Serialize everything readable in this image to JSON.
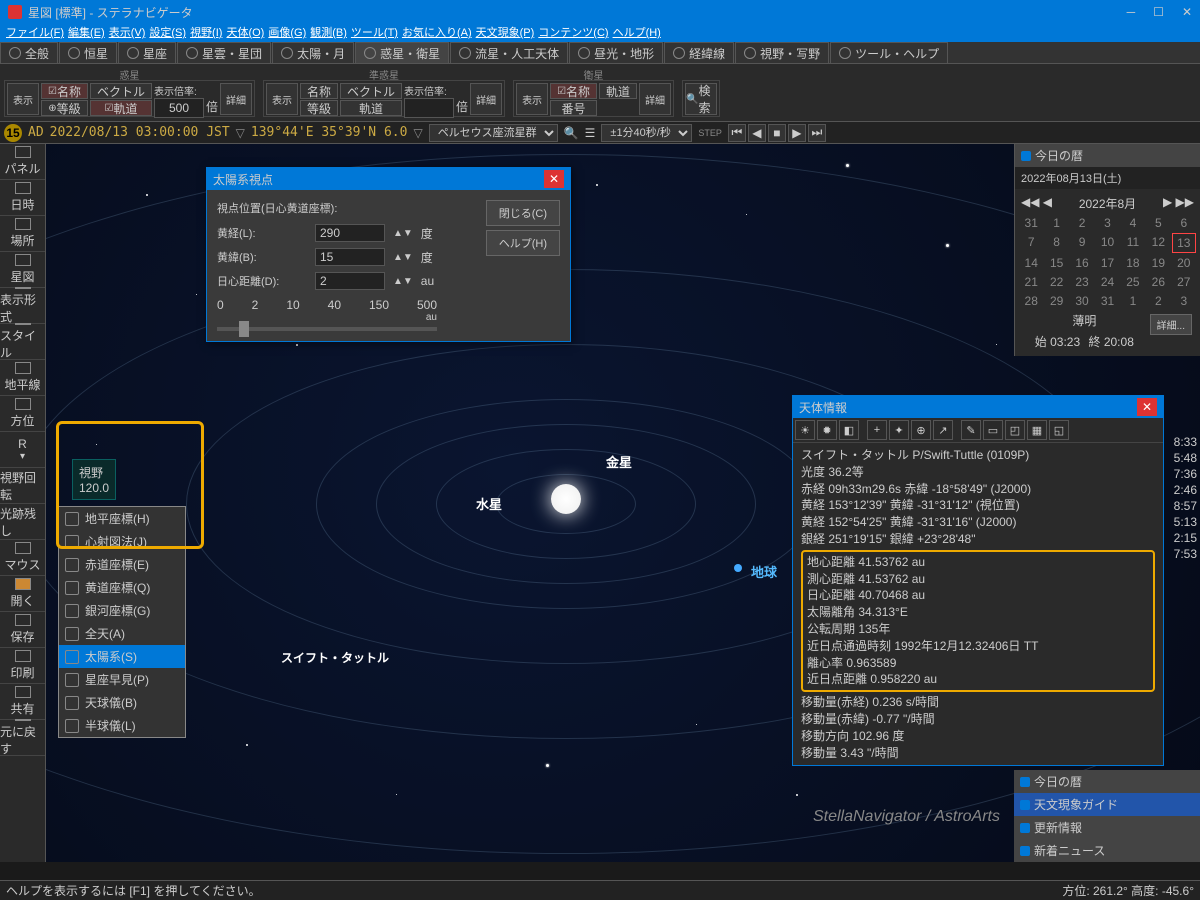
{
  "title": "星図 [標準] - ステラナビゲータ",
  "menubar": [
    "ファイル(F)",
    "編集(E)",
    "表示(V)",
    "設定(S)",
    "視野(I)",
    "天体(O)",
    "画像(G)",
    "観測(B)",
    "ツール(T)",
    "お気に入り(A)",
    "天文現象(P)",
    "コンテンツ(C)",
    "ヘルプ(H)"
  ],
  "tabs": [
    "全般",
    "恒星",
    "星座",
    "星雲・星団",
    "太陽・月",
    "惑星・衛星",
    "流星・人工天体",
    "昼光・地形",
    "経緯線",
    "視野・写野",
    "ツール・ヘルプ"
  ],
  "active_tab": 5,
  "toolbar_groups": {
    "planets": "惑星",
    "dwarfs": "準惑星",
    "satellites": "衛星"
  },
  "toolbar_buttons": {
    "display": "表示",
    "name": "名称",
    "vector": "ベクトル",
    "magnification": "表示倍率:",
    "detail": "詳細",
    "magnitude": "等級",
    "orbit": "軌道",
    "number": "番号",
    "search": "検索",
    "multiplier": "倍"
  },
  "toolbar_values": {
    "mag_planet": "500",
    "mag_dwarf": ""
  },
  "time": {
    "prefix": "AD",
    "datetime": "2022/08/13 03:00:00 JST",
    "coords": "139°44'E 35°39'N  6.0",
    "dropdown1": "ペルセウス座流星群",
    "dropdown2": "±1分40秒/秒",
    "badge": "15"
  },
  "sidebar": [
    "パネル",
    "日時",
    "場所",
    "星図",
    "表示形式",
    "スタイル",
    "地平線",
    "方位",
    "R",
    "視野回転",
    "光跡残し",
    "マウス",
    "開く",
    "保存",
    "印刷",
    "共有",
    "元に戻す"
  ],
  "fov": {
    "label": "視野",
    "value": "120.0"
  },
  "coord_menu": [
    "地平座標(H)",
    "心射図法(J)",
    "赤道座標(E)",
    "黄道座標(Q)",
    "銀河座標(G)",
    "全天(A)",
    "太陽系(S)",
    "星座早見(P)",
    "天球儀(B)",
    "半球儀(L)"
  ],
  "planets": {
    "mercury": "水星",
    "venus": "金星",
    "earth": "地球",
    "swift": "スイフト・タットル"
  },
  "viewpoint_dialog": {
    "title": "太陽系視点",
    "section": "視点位置(日心黄道座標):",
    "lon_label": "黄経(L):",
    "lon": "290",
    "lon_unit": "度",
    "lat_label": "黄緯(B):",
    "lat": "15",
    "lat_unit": "度",
    "dist_label": "日心距離(D):",
    "dist": "2",
    "dist_unit": "au",
    "scale": [
      "0",
      "2",
      "10",
      "40",
      "150",
      "500"
    ],
    "scale_unit": "au",
    "close": "閉じる(C)",
    "help": "ヘルプ(H)"
  },
  "info_dialog": {
    "title": "天体情報",
    "name": "スイフト・タットル P/Swift-Tuttle (0109P)",
    "mag": "光度 36.2等",
    "ra": "赤経 09h33m29.6s  赤緯  -18°58'49\" (J2000)",
    "ecl1": "黄経 153°12'39\"  黄緯  -31°31'12\" (視位置)",
    "ecl2": "黄経 152°54'25\"  黄緯  -31°31'16\" (J2000)",
    "gal": "銀経 251°19'15\"  銀緯  +23°28'48\"",
    "geo_dist": "地心距離 41.53762 au",
    "topo_dist": "測心距離 41.53762 au",
    "helio_dist": "日心距離 40.70468 au",
    "elong": "太陽離角 34.313°E",
    "period": "公転周期 135年",
    "perihelion": "近日点通過時刻 1992年12月12.32406日  TT",
    "ecc": "離心率 0.963589",
    "peri_dist": "近日点距離 0.958220 au",
    "motion_ra": "移動量(赤経) 0.236 s/時間",
    "motion_dec": "移動量(赤緯) -0.77 \"/時間",
    "motion_dir": "移動方向 102.96 度",
    "motion_amt": "移動量    3.43 \"/時間"
  },
  "calendar": {
    "title": "今日の暦",
    "date": "2022年08月13日(土)",
    "month": "2022年8月",
    "cells": [
      "31",
      "1",
      "2",
      "3",
      "4",
      "5",
      "6",
      "7",
      "8",
      "9",
      "10",
      "11",
      "12",
      "13",
      "14",
      "15",
      "16",
      "17",
      "18",
      "19",
      "20",
      "21",
      "22",
      "23",
      "24",
      "25",
      "26",
      "27",
      "28",
      "29",
      "30",
      "31",
      "1",
      "2",
      "3"
    ],
    "twilight": "薄明",
    "start": "始 03:23",
    "end": "終 20:08",
    "detail": "詳細..."
  },
  "side_times": [
    "8:33",
    "5:48",
    "7:36",
    "2:46",
    "8:57",
    "5:13",
    "2:15",
    "7:53"
  ],
  "bottom_panels": [
    "今日の暦",
    "天文現象ガイド",
    "更新情報",
    "新着ニュース"
  ],
  "watermark": "StellaNavigator / AstroArts",
  "statusbar": {
    "help": "ヘルプを表示するには [F1] を押してください。",
    "coords": "方位: 261.2° 高度: -45.6°"
  }
}
